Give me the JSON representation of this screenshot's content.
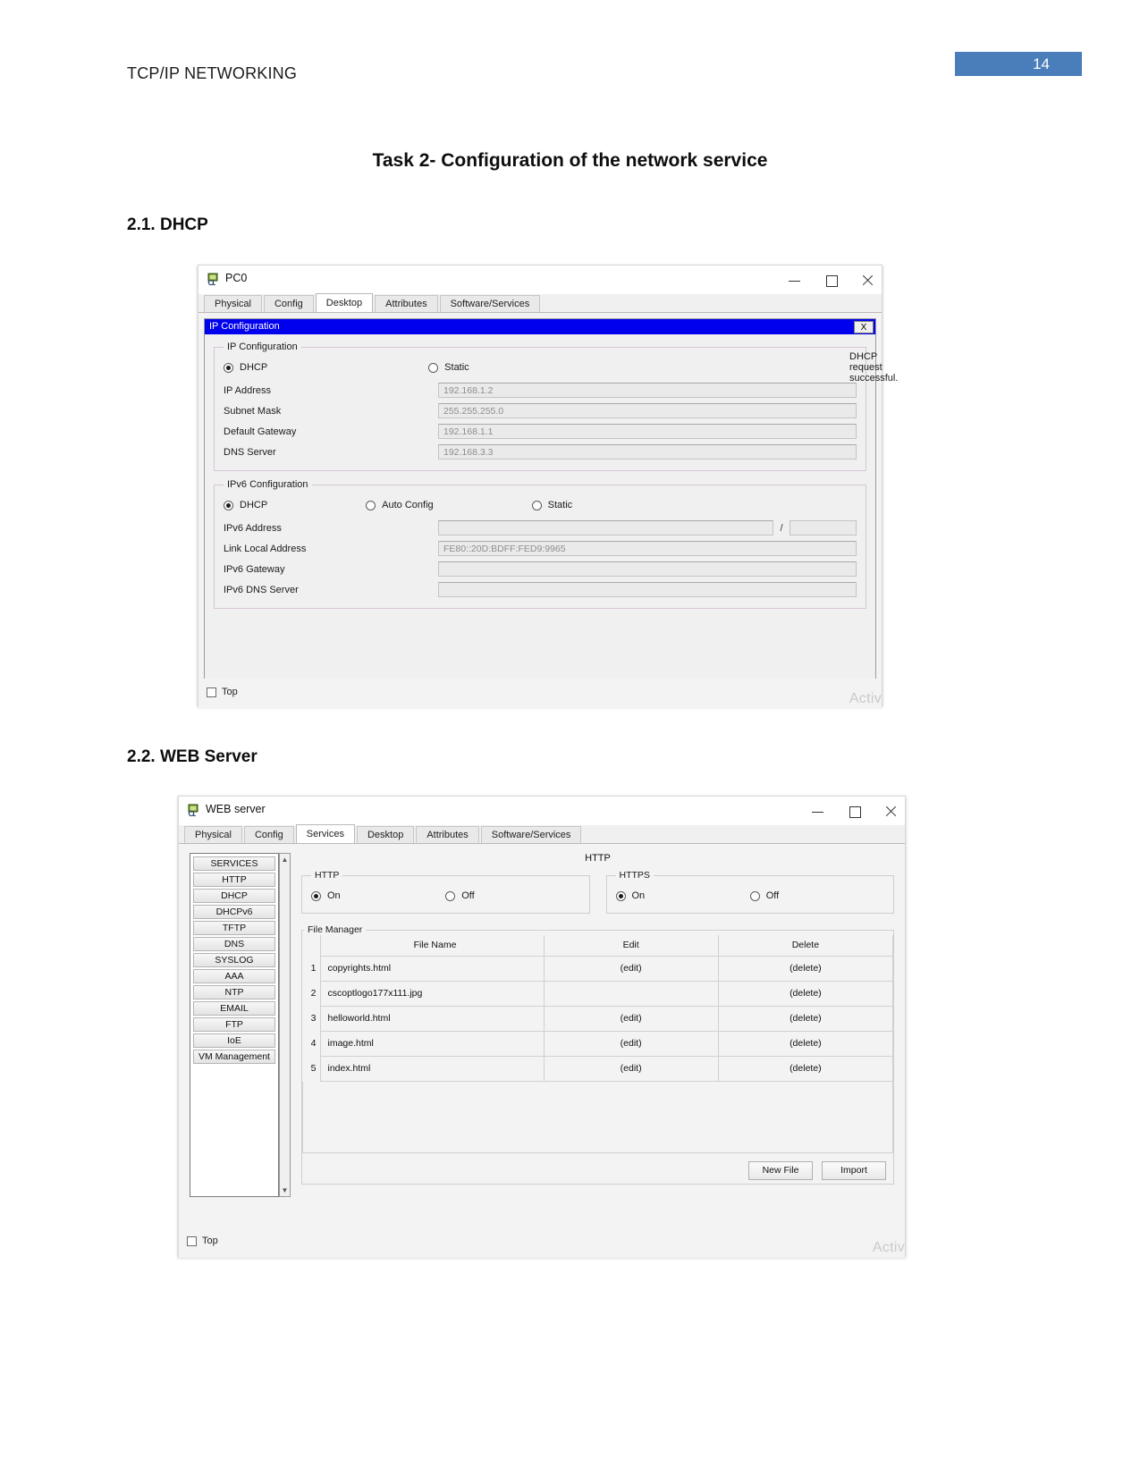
{
  "document": {
    "header_title": "TCP/IP NETWORKING",
    "page_number": "14",
    "accent_color": "#4a7ebb",
    "task_title": "Task 2- Configuration of the network service",
    "section_dhcp": "2.1. DHCP",
    "section_web": "2.2. WEB Server"
  },
  "pc_window": {
    "title": "PC0",
    "icon": "pt-device-icon",
    "window_controls": {
      "minimize": "minimize-icon",
      "maximize": "maximize-icon",
      "close": "close-icon"
    },
    "tabs": [
      {
        "label": "Physical",
        "active": false
      },
      {
        "label": "Config",
        "active": false
      },
      {
        "label": "Desktop",
        "active": true
      },
      {
        "label": "Attributes",
        "active": false
      },
      {
        "label": "Software/Services",
        "active": false
      }
    ],
    "dialog": {
      "titlebar": "IP Configuration",
      "close_label": "X",
      "ipv4": {
        "legend": "IP Configuration",
        "mode_dhcp": "DHCP",
        "mode_static": "Static",
        "selected_mode": "DHCP",
        "status": "DHCP request successful.",
        "fields": [
          {
            "label": "IP Address",
            "value": "192.168.1.2"
          },
          {
            "label": "Subnet Mask",
            "value": "255.255.255.0"
          },
          {
            "label": "Default Gateway",
            "value": "192.168.1.1"
          },
          {
            "label": "DNS Server",
            "value": "192.168.3.3"
          }
        ]
      },
      "ipv6": {
        "legend": "IPv6 Configuration",
        "mode_dhcp": "DHCP",
        "mode_auto": "Auto Config",
        "mode_static": "Static",
        "selected_mode": "DHCP",
        "slash": "/",
        "fields": [
          {
            "label": "IPv6 Address",
            "value": ""
          },
          {
            "label": "Link Local Address",
            "value": "FE80::20D:BDFF:FED9:9965"
          },
          {
            "label": "IPv6 Gateway",
            "value": ""
          },
          {
            "label": "IPv6 DNS Server",
            "value": ""
          }
        ]
      }
    },
    "footer": {
      "top_checkbox_label": "Top",
      "top_checked": false,
      "watermark": "Activ"
    }
  },
  "web_window": {
    "title": "WEB server",
    "icon": "pt-device-icon",
    "window_controls": {
      "minimize": "minimize-icon",
      "maximize": "maximize-icon",
      "close": "close-icon"
    },
    "tabs": [
      {
        "label": "Physical",
        "active": false
      },
      {
        "label": "Config",
        "active": false
      },
      {
        "label": "Services",
        "active": true
      },
      {
        "label": "Desktop",
        "active": false
      },
      {
        "label": "Attributes",
        "active": false
      },
      {
        "label": "Software/Services",
        "active": false
      }
    ],
    "services_list": [
      "SERVICES",
      "HTTP",
      "DHCP",
      "DHCPv6",
      "TFTP",
      "DNS",
      "SYSLOG",
      "AAA",
      "NTP",
      "EMAIL",
      "FTP",
      "IoE",
      "VM Management"
    ],
    "selected_service": "HTTP",
    "panel_heading": "HTTP",
    "http": {
      "legend": "HTTP",
      "on_label": "On",
      "off_label": "Off",
      "selected": "On"
    },
    "https": {
      "legend": "HTTPS",
      "on_label": "On",
      "off_label": "Off",
      "selected": "On"
    },
    "file_manager": {
      "legend": "File Manager",
      "columns": [
        "File Name",
        "Edit",
        "Delete"
      ],
      "rows": [
        {
          "index": "1",
          "name": "copyrights.html",
          "edit": "(edit)",
          "delete": "(delete)"
        },
        {
          "index": "2",
          "name": "cscoptlogo177x111.jpg",
          "edit": "",
          "delete": "(delete)"
        },
        {
          "index": "3",
          "name": "helloworld.html",
          "edit": "(edit)",
          "delete": "(delete)"
        },
        {
          "index": "4",
          "name": "image.html",
          "edit": "(edit)",
          "delete": "(delete)"
        },
        {
          "index": "5",
          "name": "index.html",
          "edit": "(edit)",
          "delete": "(delete)"
        }
      ],
      "new_file_button": "New File",
      "import_button": "Import"
    },
    "footer": {
      "top_checkbox_label": "Top",
      "top_checked": false,
      "watermark": "Activ"
    }
  }
}
